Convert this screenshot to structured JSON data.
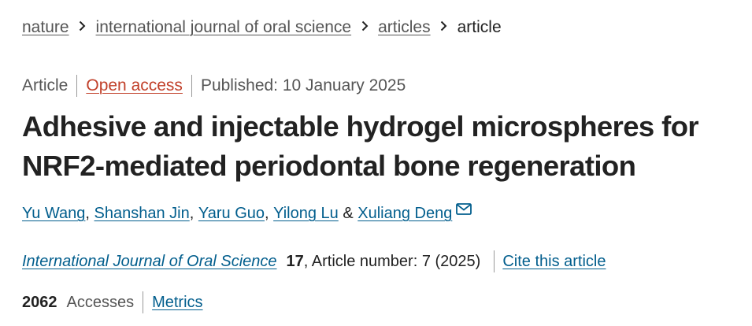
{
  "breadcrumb": {
    "items": [
      "nature",
      "international journal of oral science",
      "articles"
    ],
    "current": "article"
  },
  "meta": {
    "type": "Article",
    "open_access": "Open access",
    "published": "Published: 10 January 2025"
  },
  "title": {
    "line1": "Adhesive and injectable hydrogel microspheres for",
    "line2": "NRF2-mediated periodontal bone regeneration"
  },
  "authors": {
    "names": [
      "Yu Wang",
      "Shanshan Jin",
      "Yaru Guo",
      "Yilong Lu",
      "Xuliang Deng"
    ],
    "sep": ", ",
    "amp": " & "
  },
  "citation": {
    "journal": "International Journal of Oral Science",
    "volume": "17",
    "article_number": ", Article number: 7 (2025)",
    "cite_link": "Cite this article"
  },
  "metrics": {
    "count": "2062",
    "label": "Accesses",
    "link": "Metrics"
  },
  "icons": {
    "separator": "chevron-right-icon",
    "mail": "envelope-icon"
  },
  "colors": {
    "link": "#025e8d",
    "open_access": "#c1402a",
    "text": "#222222",
    "muted": "#555555"
  }
}
